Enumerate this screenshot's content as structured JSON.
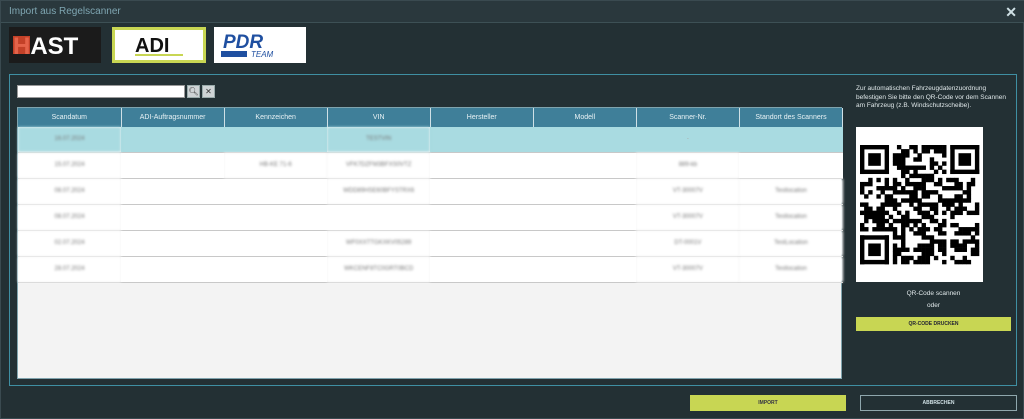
{
  "window": {
    "title": "Import aus Regelscanner"
  },
  "logos": {
    "hast": "HAST",
    "adi": "ADI",
    "pdr_main": "PDR",
    "pdr_sub": "TEAM"
  },
  "search": {
    "placeholder": "",
    "value": ""
  },
  "table": {
    "columns": [
      "Scandatum",
      "ADI-Auftragsnummer",
      "Kennzeichen",
      "VIN",
      "Hersteller",
      "Modell",
      "Scanner-Nr.",
      "Standort des Scanners"
    ],
    "rows": [
      [
        "16.07.2024",
        "",
        "",
        "TESTVIN",
        "",
        "",
        "-",
        ""
      ],
      [
        "15.07.2024",
        "",
        "HB-KE 71-6",
        "VFK7DZFM3BFXS0VTZ",
        "",
        "",
        "889-kb",
        ""
      ],
      [
        "08.07.2024",
        "",
        "",
        "WDD89HSE60BFYSTRX6",
        "",
        "",
        "VT-30007V",
        "Testlocation"
      ],
      [
        "08.07.2024",
        "",
        "",
        "",
        "",
        "",
        "VT-30007V",
        "Testlocation"
      ],
      [
        "02.07.2024",
        "",
        "",
        "WF0XXTTGKXKV05289",
        "",
        "",
        "DT-0001V",
        "TestLocation"
      ],
      [
        "28.07.2024",
        "",
        "",
        "WKCENF8TC0GRT0BCD",
        "",
        "",
        "VT-30007V",
        "Testlocation"
      ]
    ]
  },
  "side": {
    "info": "Zur automatischen Fahrzeugdatenzuordnung befestigen Sie bitte den QR-Code vor dem Scannen am Fahrzeug (z.B. Windschutzscheibe).",
    "qr_label": "QR-Code scannen",
    "or": "oder",
    "print_label": "QR-CODE DRUCKEN"
  },
  "footer": {
    "import_label": "IMPORT",
    "cancel_label": "ABBRECHEN"
  },
  "colors": {
    "accent": "#c8d653",
    "header": "#3f7f99",
    "selected_row": "#a9dbe1"
  }
}
